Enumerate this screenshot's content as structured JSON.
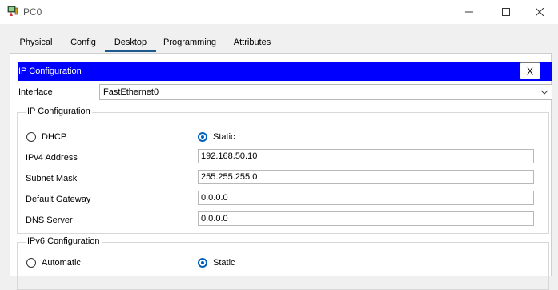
{
  "window": {
    "title": "PC0"
  },
  "tabs": [
    {
      "label": "Physical"
    },
    {
      "label": "Config"
    },
    {
      "label": "Desktop"
    },
    {
      "label": "Programming"
    },
    {
      "label": "Attributes"
    }
  ],
  "panel": {
    "title": "IP Configuration",
    "close_label": "X"
  },
  "interface": {
    "label": "Interface",
    "value": "FastEthernet0"
  },
  "ipv4": {
    "group_label": "IP Configuration",
    "dhcp_label": "DHCP",
    "static_label": "Static",
    "mode_selected": "Static",
    "fields": [
      {
        "label": "IPv4 Address",
        "value": "192.168.50.10"
      },
      {
        "label": "Subnet Mask",
        "value": "255.255.255.0"
      },
      {
        "label": "Default Gateway",
        "value": "0.0.0.0"
      },
      {
        "label": "DNS Server",
        "value": "0.0.0.0"
      }
    ]
  },
  "ipv6": {
    "group_label": "IPv6 Configuration",
    "automatic_label": "Automatic",
    "static_label": "Static",
    "mode_selected": "Static"
  },
  "colors": {
    "header_bg": "#0000ff",
    "accent": "#005fb8",
    "tab_underline": "#1e5a8c"
  }
}
